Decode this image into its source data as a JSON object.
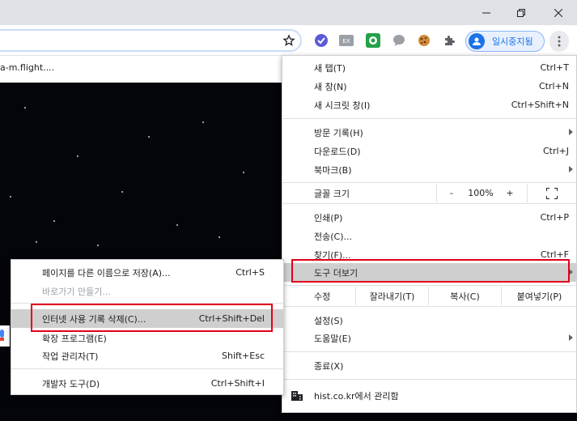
{
  "window_controls": {
    "minimize_icon": "minimize-icon",
    "restore_icon": "restore-icon",
    "close_icon": "close-icon"
  },
  "bookmarks_bar": {
    "visible_text": "a-m.flight...."
  },
  "toolbar": {
    "profile_label": "일시중지됨",
    "extensions": [
      "vpn-check-icon",
      "ex-extension-icon",
      "green-extension-icon",
      "speech-bubble-icon",
      "cookie-icon",
      "puzzle-icon"
    ]
  },
  "main_menu": {
    "new_tab": {
      "label": "새 탭(T)",
      "shortcut": "Ctrl+T"
    },
    "new_window": {
      "label": "새 창(N)",
      "shortcut": "Ctrl+N"
    },
    "incognito": {
      "label": "새 시크릿 창(I)",
      "shortcut": "Ctrl+Shift+N"
    },
    "history": {
      "label": "방문 기록(H)"
    },
    "downloads": {
      "label": "다운로드(D)",
      "shortcut": "Ctrl+J"
    },
    "bookmarks": {
      "label": "북마크(B)"
    },
    "zoom": {
      "label": "글꼴 크기",
      "minus": "-",
      "value": "100%",
      "plus": "+"
    },
    "print": {
      "label": "인쇄(P)",
      "shortcut": "Ctrl+P"
    },
    "cast": {
      "label": "전송(C)..."
    },
    "find": {
      "label": "찾기(F)...",
      "shortcut": "Ctrl+F"
    },
    "more_tools": {
      "label": "도구 더보기"
    },
    "edit": {
      "label": "수정",
      "cut": "잘라내기(T)",
      "copy": "복사(C)",
      "paste": "붙여넣기(P)"
    },
    "settings": {
      "label": "설정(S)"
    },
    "help": {
      "label": "도움말(E)"
    },
    "exit": {
      "label": "종료(X)"
    },
    "managed": {
      "label": "hist.co.kr에서 관리함"
    }
  },
  "sub_menu": {
    "save_page": {
      "label": "페이지를 다른 이름으로 저장(A)...",
      "shortcut": "Ctrl+S"
    },
    "create_shortcut": {
      "label": "바로가기 만들기..."
    },
    "clear_browsing": {
      "label": "인터넷 사용 기록 삭제(C)...",
      "shortcut": "Ctrl+Shift+Del"
    },
    "extensions": {
      "label": "확장 프로그램(E)"
    },
    "task_manager": {
      "label": "작업 관리자(T)",
      "shortcut": "Shift+Esc"
    },
    "dev_tools": {
      "label": "개발자 도구(D)",
      "shortcut": "Ctrl+Shift+I"
    }
  },
  "colors": {
    "highlight_box": "#e1001c",
    "accent": "#1a73e8"
  }
}
